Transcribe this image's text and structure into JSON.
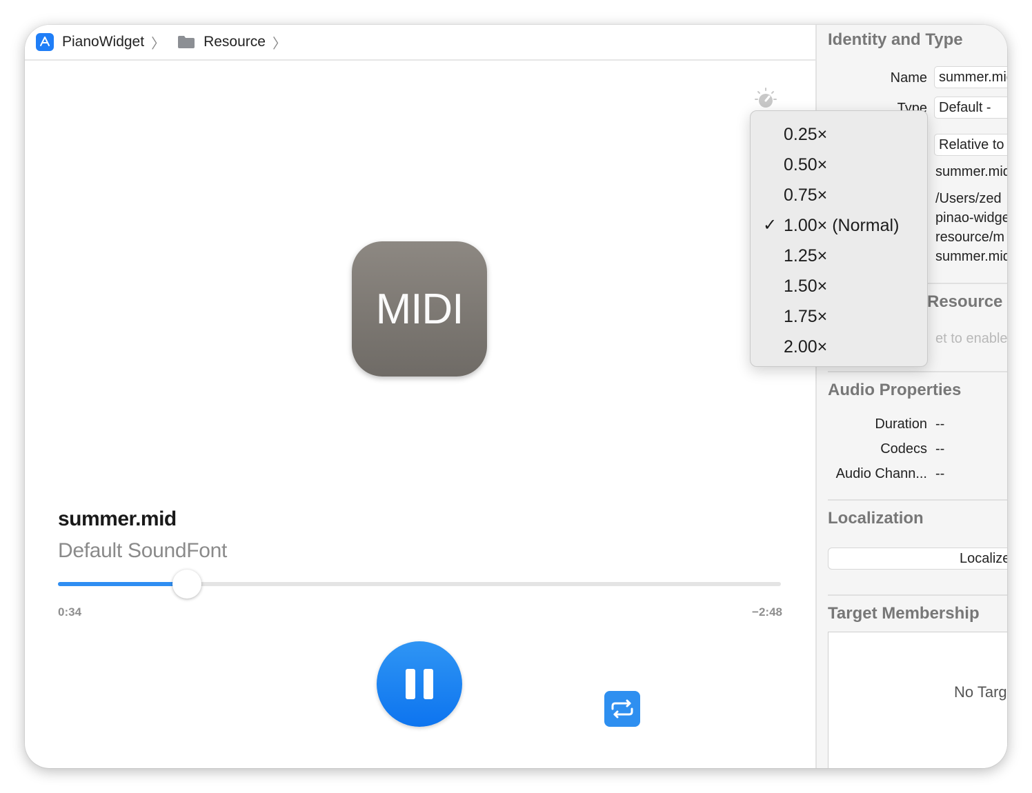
{
  "breadcrumb": {
    "project": "PianoWidget",
    "folder": "Resource"
  },
  "player": {
    "file_name": "summer.mid",
    "soundfont": "Default SoundFont",
    "artwork_label": "MIDI",
    "elapsed": "0:34",
    "remaining": "−2:48",
    "progress_fraction": 0.178,
    "state": "playing"
  },
  "speed_menu": {
    "options": [
      {
        "label": "0.25×",
        "checked": false
      },
      {
        "label": "0.50×",
        "checked": false
      },
      {
        "label": "0.75×",
        "checked": false
      },
      {
        "label": "1.00× (Normal)",
        "checked": true
      },
      {
        "label": "1.25×",
        "checked": false
      },
      {
        "label": "1.50×",
        "checked": false
      },
      {
        "label": "1.75×",
        "checked": false
      },
      {
        "label": "2.00×",
        "checked": false
      }
    ],
    "check_glyph": "✓"
  },
  "inspector": {
    "identity": {
      "title": "Identity and Type",
      "name_label": "Name",
      "name_value": "summer.mid",
      "type_label": "Type",
      "type_value": "Default - ",
      "location_value": "Relative to Group",
      "filename_value": "summer.mid",
      "fullpath_lines": [
        "/Users/zed",
        "pinao-widget",
        "resource/m",
        "summer.mid"
      ]
    },
    "resource": {
      "title": "Resource",
      "hint": "et to enable"
    },
    "audio": {
      "title": "Audio Properties",
      "rows": [
        {
          "label": "Duration",
          "value": "--"
        },
        {
          "label": "Codecs",
          "value": "--"
        },
        {
          "label": "Audio Chann...",
          "value": "--"
        }
      ]
    },
    "localization": {
      "title": "Localization",
      "button_label": "Localize..."
    },
    "target_membership": {
      "title": "Target Membership",
      "empty_text": "No Targets"
    }
  },
  "colors": {
    "accent": "#1f7ef7",
    "progress": "#2f8ef2",
    "midi_tile": "#7e7a75"
  }
}
